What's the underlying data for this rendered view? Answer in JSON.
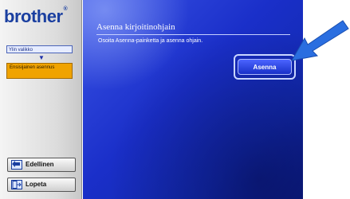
{
  "sidebar": {
    "logo_text": "brother",
    "logo_mark": "®",
    "menu_top_label": "Ylin valikko",
    "menu_selected_label": "Ensisijainen asennus",
    "back_label": "Edellinen",
    "quit_label": "Lopeta"
  },
  "main": {
    "title": "Asenna kirjoitinohjain",
    "instruction": "Osoita Asenna-painketta ja asenna ohjain.",
    "install_label": "Asenna"
  },
  "colors": {
    "brand_blue": "#1a3fa0",
    "panel_blue": "#1a2fc9",
    "selected_orange": "#f0a300",
    "arrow_blue": "#2a6ee0"
  }
}
